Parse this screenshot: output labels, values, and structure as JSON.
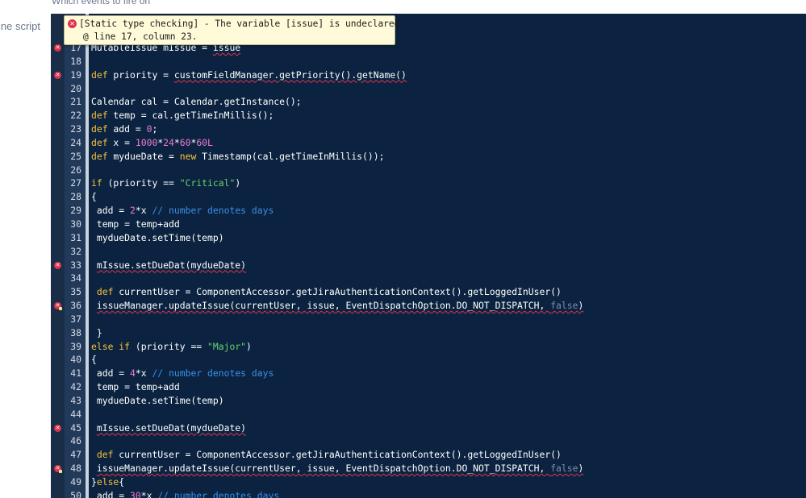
{
  "page": {
    "top_hint": "Which events to fire on",
    "side_label": "ine script"
  },
  "tooltip": {
    "line1": "[Static type checking] - The variable [issue] is undeclared.",
    "line2": "@ line 17, column 23."
  },
  "colors": {
    "editor_bg": "#0b2340",
    "keyword": "#f7c03c",
    "string": "#6ad16a",
    "number": "#f07bd2",
    "comment": "#3a8ee6",
    "error": "#e0334e"
  },
  "icons": {
    "error_marker": "error-circle-icon",
    "error_fix_marker": "error-quickfix-icon"
  },
  "lines": [
    {
      "n": "17",
      "marker": "error",
      "tokens": [
        [
          "plain",
          "MutableIssue mIssue = "
        ],
        [
          "sq",
          "issue"
        ]
      ]
    },
    {
      "n": "18",
      "marker": "",
      "tokens": []
    },
    {
      "n": "19",
      "marker": "error",
      "tokens": [
        [
          "kw",
          "def"
        ],
        [
          "plain",
          " priority = "
        ],
        [
          "sq",
          "customFieldManager.getPriority().getName()"
        ]
      ]
    },
    {
      "n": "20",
      "marker": "",
      "tokens": []
    },
    {
      "n": "21",
      "marker": "",
      "tokens": [
        [
          "plain",
          "Calendar cal = Calendar.getInstance();"
        ]
      ]
    },
    {
      "n": "22",
      "marker": "",
      "tokens": [
        [
          "kw",
          "def"
        ],
        [
          "plain",
          " temp = cal.getTimeInMillis();"
        ]
      ]
    },
    {
      "n": "23",
      "marker": "",
      "tokens": [
        [
          "kw",
          "def"
        ],
        [
          "plain",
          " add = "
        ],
        [
          "num",
          "0"
        ],
        [
          "plain",
          ";"
        ]
      ]
    },
    {
      "n": "24",
      "marker": "",
      "tokens": [
        [
          "kw",
          "def"
        ],
        [
          "plain",
          " x = "
        ],
        [
          "num",
          "1000"
        ],
        [
          "plain",
          "*"
        ],
        [
          "num",
          "24"
        ],
        [
          "plain",
          "*"
        ],
        [
          "num",
          "60"
        ],
        [
          "plain",
          "*"
        ],
        [
          "num",
          "60L"
        ]
      ]
    },
    {
      "n": "25",
      "marker": "",
      "tokens": [
        [
          "kw",
          "def"
        ],
        [
          "plain",
          " mydueDate = "
        ],
        [
          "kw",
          "new"
        ],
        [
          "plain",
          " Timestamp(cal.getTimeInMillis());"
        ]
      ]
    },
    {
      "n": "26",
      "marker": "",
      "tokens": []
    },
    {
      "n": "27",
      "marker": "",
      "tokens": [
        [
          "kw",
          "if"
        ],
        [
          "plain",
          " (priority == "
        ],
        [
          "str",
          "\"Critical\""
        ],
        [
          "plain",
          ")"
        ]
      ]
    },
    {
      "n": "28",
      "marker": "",
      "tokens": [
        [
          "plain",
          "{"
        ]
      ]
    },
    {
      "n": "29",
      "marker": "",
      "tokens": [
        [
          "plain",
          " add = "
        ],
        [
          "num",
          "2"
        ],
        [
          "plain",
          "*x "
        ],
        [
          "cmt",
          "// number denotes days"
        ]
      ]
    },
    {
      "n": "30",
      "marker": "",
      "tokens": [
        [
          "plain",
          " temp = temp+add"
        ]
      ]
    },
    {
      "n": "31",
      "marker": "",
      "tokens": [
        [
          "plain",
          " mydueDate.setTime(temp)"
        ]
      ]
    },
    {
      "n": "32",
      "marker": "",
      "tokens": []
    },
    {
      "n": "33",
      "marker": "error",
      "tokens": [
        [
          "plain",
          " "
        ],
        [
          "sq",
          "mIssue.setDueDat(mydueDate)"
        ]
      ]
    },
    {
      "n": "34",
      "marker": "",
      "tokens": []
    },
    {
      "n": "35",
      "marker": "",
      "tokens": [
        [
          "plain",
          " "
        ],
        [
          "kw",
          "def"
        ],
        [
          "plain",
          " currentUser = ComponentAccessor.getJiraAuthenticationContext().getLoggedInUser()"
        ]
      ]
    },
    {
      "n": "36",
      "marker": "fix",
      "tokens": [
        [
          "plain",
          " "
        ],
        [
          "sq",
          "issueManager.updateIssue(currentUser, issue, EventDispatchOption.DO_NOT_DISPATCH, "
        ],
        [
          "sqbool",
          "false"
        ],
        [
          "sq",
          ")"
        ]
      ]
    },
    {
      "n": "37",
      "marker": "",
      "tokens": []
    },
    {
      "n": "38",
      "marker": "",
      "tokens": [
        [
          "plain",
          " }"
        ]
      ]
    },
    {
      "n": "39",
      "marker": "",
      "tokens": [
        [
          "kw",
          "else"
        ],
        [
          "plain",
          " "
        ],
        [
          "kw",
          "if"
        ],
        [
          "plain",
          " (priority == "
        ],
        [
          "str",
          "\"Major\""
        ],
        [
          "plain",
          ")"
        ]
      ]
    },
    {
      "n": "40",
      "marker": "",
      "tokens": [
        [
          "plain",
          "{"
        ]
      ]
    },
    {
      "n": "41",
      "marker": "",
      "tokens": [
        [
          "plain",
          " add = "
        ],
        [
          "num",
          "4"
        ],
        [
          "plain",
          "*x "
        ],
        [
          "cmt",
          "// number denotes days"
        ]
      ]
    },
    {
      "n": "42",
      "marker": "",
      "tokens": [
        [
          "plain",
          " temp = temp+add"
        ]
      ]
    },
    {
      "n": "43",
      "marker": "",
      "tokens": [
        [
          "plain",
          " mydueDate.setTime(temp)"
        ]
      ]
    },
    {
      "n": "44",
      "marker": "",
      "tokens": []
    },
    {
      "n": "45",
      "marker": "error",
      "tokens": [
        [
          "plain",
          " "
        ],
        [
          "sq",
          "mIssue.setDueDat(mydueDate)"
        ]
      ]
    },
    {
      "n": "46",
      "marker": "",
      "tokens": []
    },
    {
      "n": "47",
      "marker": "",
      "tokens": [
        [
          "plain",
          " "
        ],
        [
          "kw",
          "def"
        ],
        [
          "plain",
          " currentUser = ComponentAccessor.getJiraAuthenticationContext().getLoggedInUser()"
        ]
      ]
    },
    {
      "n": "48",
      "marker": "fix",
      "tokens": [
        [
          "plain",
          " "
        ],
        [
          "sq",
          "issueManager.updateIssue(currentUser, issue, EventDispatchOption.DO_NOT_DISPATCH, "
        ],
        [
          "sqbool",
          "false"
        ],
        [
          "sq",
          ")"
        ]
      ]
    },
    {
      "n": "49",
      "marker": "",
      "tokens": [
        [
          "plain",
          "}"
        ],
        [
          "kw",
          "else"
        ],
        [
          "plain",
          "{"
        ]
      ]
    },
    {
      "n": "50",
      "marker": "",
      "tokens": [
        [
          "plain",
          " add = "
        ],
        [
          "num",
          "30"
        ],
        [
          "plain",
          "*x "
        ],
        [
          "cmt",
          "// number denotes days"
        ]
      ]
    }
  ]
}
